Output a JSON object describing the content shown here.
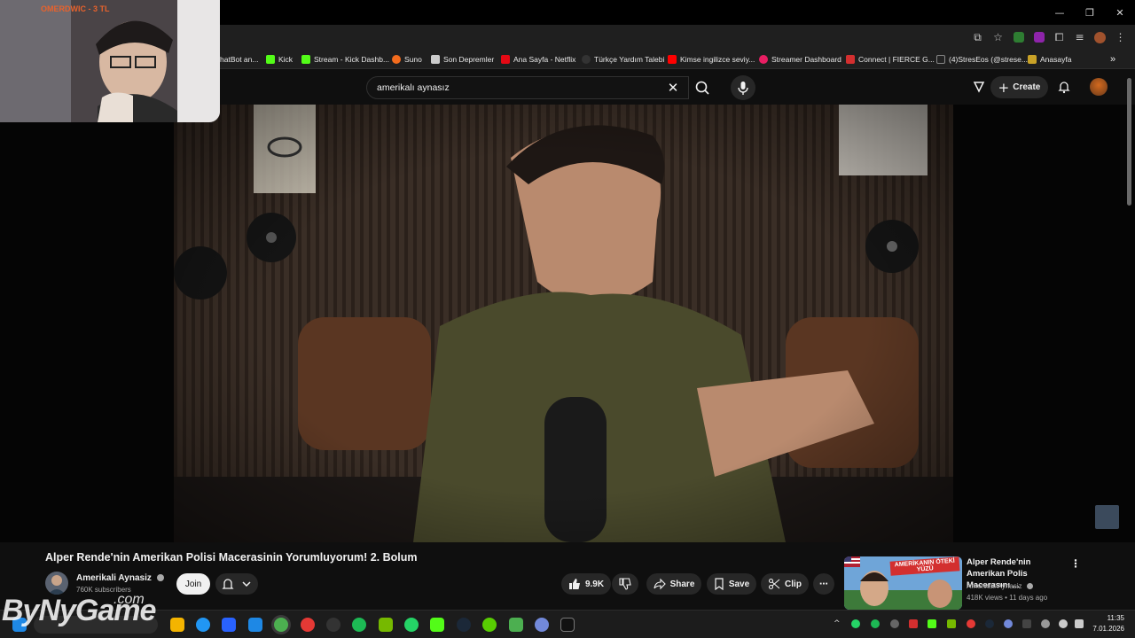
{
  "browser": {
    "window_controls": [
      "—",
      "❐",
      "✕"
    ],
    "bookmarks": [
      {
        "label": "hatBot an...",
        "color": "#2a6ee0"
      },
      {
        "label": "Kick",
        "color": "#53fc18"
      },
      {
        "label": "Stream - Kick Dashb...",
        "color": "#53fc18"
      },
      {
        "label": "Suno",
        "color": "#f26b1d"
      },
      {
        "label": "Son Depremler",
        "color": "#cccccc"
      },
      {
        "label": "Ana Sayfa - Netflix",
        "color": "#e50914"
      },
      {
        "label": "Türkçe Yardım Talebi",
        "color": "#333333"
      },
      {
        "label": "Kimse ingilizce seviy...",
        "color": "#ff0000"
      },
      {
        "label": "Streamer Dashboard",
        "color": "#e91e63"
      },
      {
        "label": "Connect | FIERCE G...",
        "color": "#d32f2f"
      },
      {
        "label": "(4)StresEos (@strese...",
        "color": "#222222"
      },
      {
        "label": "Anasayfa",
        "color": "#c9a227"
      }
    ],
    "bookmarks_overflow": "»"
  },
  "webcam": {
    "name": "OMERDWIC - 3 TL"
  },
  "youtube": {
    "search": {
      "value": "amerikalı aynasız"
    },
    "create_label": "Create",
    "video": {
      "title": "Alper Rende'nin Amerikan Polisi Macerasinin Yorumluyorum! 2. Bolum",
      "channel": "Amerikali Aynasiz",
      "subscribers": "760K subscribers",
      "join_label": "Join",
      "likes": "9.9K",
      "share_label": "Share",
      "save_label": "Save",
      "clip_label": "Clip"
    },
    "recommendation": {
      "title": "Alper Rende'nin Amerikan Polis Macerasını ...",
      "channel": "Amerikali Aynasiz",
      "meta": "418K views • 11 days ago",
      "thumb_text": "AMERİKANIN ÖTEKİ YÜZÜ"
    }
  },
  "watermark": {
    "main": "ByNyGame",
    "suffix": ".com"
  },
  "taskbar": {
    "time": "11:35",
    "date": "7.01.2026",
    "icons": [
      "#1e88e5",
      "#f4b400",
      "#2196f3",
      "#2962ff",
      "#1e88e5",
      "#4caf50",
      "#e53935",
      "#333333",
      "#1db954",
      "#76b900",
      "#25d366",
      "#53fc18",
      "#1b2838",
      "#58cc02",
      "#4caf50",
      "#7289da",
      "#111111"
    ]
  }
}
